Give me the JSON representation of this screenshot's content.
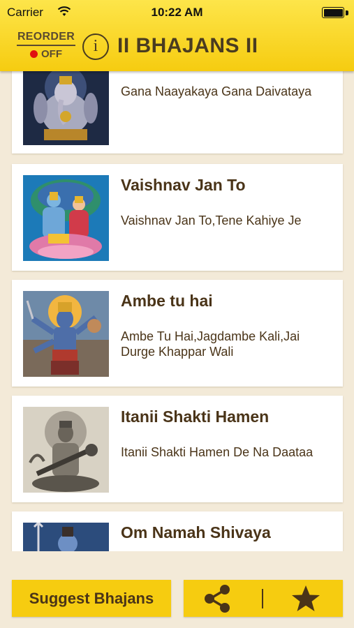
{
  "status_bar": {
    "carrier": "Carrier",
    "time": "10:22 AM"
  },
  "header": {
    "reorder_label": "REORDER",
    "reorder_state": "OFF",
    "info_glyph": "i",
    "title": "II BHAJANS II"
  },
  "bhajans": [
    {
      "title": "",
      "subtitle": "Gana Naayakaya Gana Daivataya",
      "image_icon": "ganesha-image"
    },
    {
      "title": "Vaishnav Jan To",
      "subtitle": "Vaishnav Jan To,Tene Kahiye Je",
      "image_icon": "vishnu-lakshmi-image"
    },
    {
      "title": "Ambe tu hai",
      "subtitle": "Ambe Tu Hai,Jagdambe Kali,Jai Durge Khappar Wali",
      "image_icon": "kali-image"
    },
    {
      "title": "Itanii Shakti Hamen",
      "subtitle": "Itanii Shakti Hamen De Na Daataa",
      "image_icon": "saraswati-image"
    },
    {
      "title": "Om Namah Shivaya",
      "subtitle": "",
      "image_icon": "shiva-image"
    }
  ],
  "bottom": {
    "suggest_label": "Suggest Bhajans",
    "share_icon": "share-icon",
    "favorite_icon": "star-icon"
  },
  "colors": {
    "accent_yellow": "#f6cc10",
    "background": "#f3ead8",
    "text_brown": "#4a3418",
    "reorder_off_dot": "#e01010"
  }
}
